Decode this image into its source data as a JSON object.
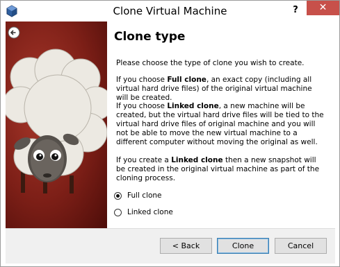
{
  "window": {
    "title": "Clone Virtual Machine",
    "help_label": "?",
    "close_label": "✕"
  },
  "page": {
    "title": "Clone type",
    "intro": "Please choose the type of clone you wish to create.",
    "full": {
      "prefix": "If you choose ",
      "bold": "Full clone",
      "suffix": ", an exact copy (including all virtual hard drive files) of the original virtual machine will be created."
    },
    "linked": {
      "prefix": "If you choose ",
      "bold": "Linked clone",
      "suffix": ", a new machine will be created, but the virtual hard drive files will be tied to the virtual hard drive files of original machine and you will not be able to move the new virtual machine to a different computer without moving the original as well."
    },
    "snapshot": {
      "prefix": "If you create a ",
      "bold": "Linked clone",
      "suffix": " then a new snapshot will be created in the original virtual machine as part of the cloning process."
    }
  },
  "options": {
    "full_clone": "Full clone",
    "linked_clone": "Linked clone",
    "selected": "full_clone"
  },
  "buttons": {
    "back": "< Back",
    "clone": "Clone",
    "cancel": "Cancel"
  }
}
